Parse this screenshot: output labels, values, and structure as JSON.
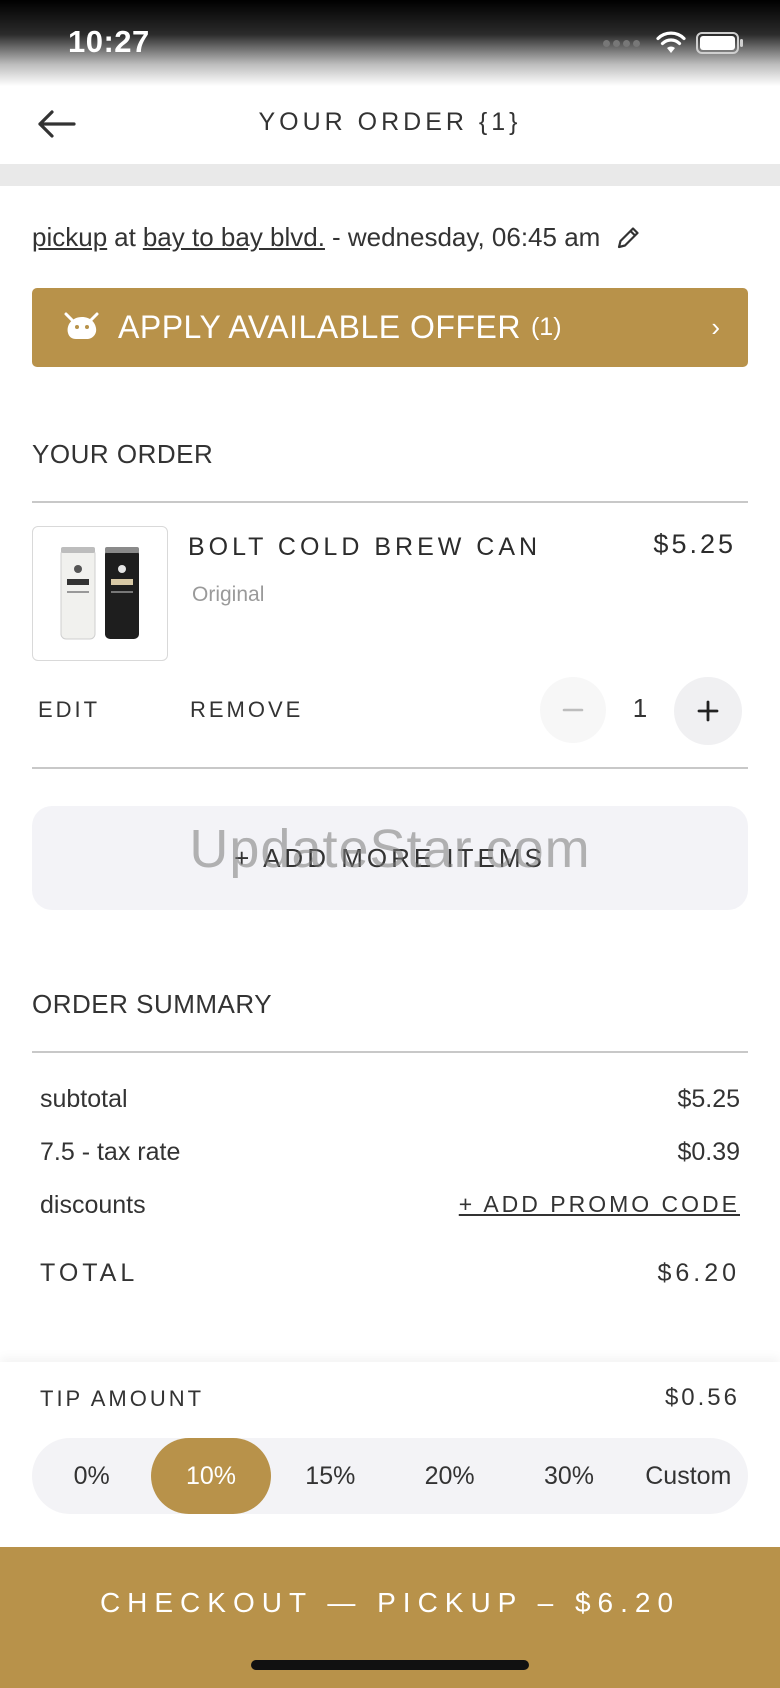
{
  "status_bar": {
    "time": "10:27"
  },
  "header": {
    "title": "YOUR ORDER {1}"
  },
  "pickup": {
    "mode": "pickup",
    "connector": "at",
    "location": "bay to bay blvd.",
    "schedule": "- wednesday, 06:45 am"
  },
  "offer": {
    "label": "APPLY AVAILABLE OFFER",
    "count": "(1)"
  },
  "order": {
    "heading": "YOUR ORDER",
    "item": {
      "name": "BOLT COLD BREW CAN",
      "price": "$5.25",
      "variant": "Original",
      "edit_label": "EDIT",
      "remove_label": "REMOVE",
      "quantity": "1"
    },
    "add_more_label": "+ ADD MORE ITEMS"
  },
  "watermark": "UpdateStar.com",
  "summary": {
    "heading": "ORDER SUMMARY",
    "subtotal_label": "subtotal",
    "subtotal_value": "$5.25",
    "tax_label": "7.5 - tax rate",
    "tax_value": "$0.39",
    "discounts_label": "discounts",
    "promo_label": "+ ADD PROMO CODE",
    "total_label": "TOTAL",
    "total_value": "$6.20"
  },
  "tip": {
    "label": "TIP AMOUNT",
    "amount": "$0.56",
    "options": [
      "0%",
      "10%",
      "15%",
      "20%",
      "30%",
      "Custom"
    ],
    "selected": "10%"
  },
  "checkout": {
    "label": "CHECKOUT — PICKUP – $6.20"
  },
  "colors": {
    "accent": "#b8924a",
    "divider": "#e9e9e9"
  }
}
